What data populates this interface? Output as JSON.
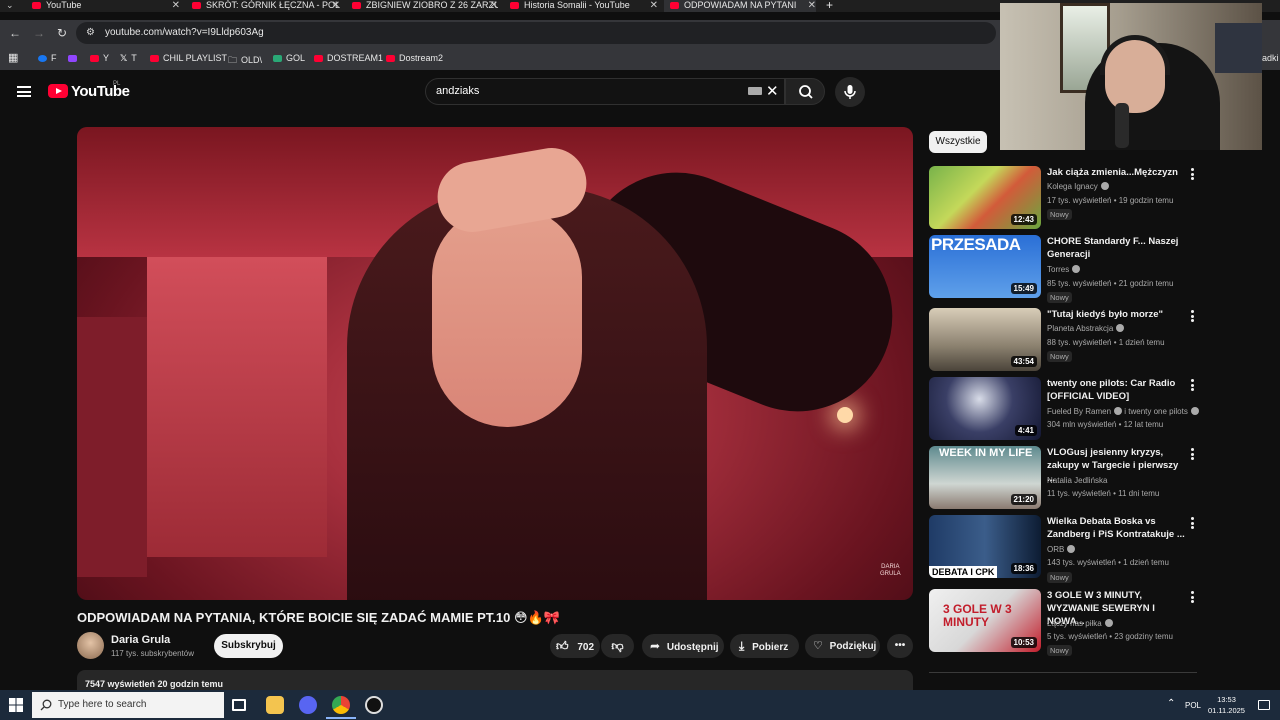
{
  "browser": {
    "tabs": [
      {
        "title": "YouTube"
      },
      {
        "title": "SKRÓT: GÓRNIK ŁĘCZNA - POL"
      },
      {
        "title": "ZBIGNIEW ZIOBRO Z 26 ZARZU"
      },
      {
        "title": "Historia Somalii - YouTube"
      },
      {
        "title": "ODPOWIADAM NA PYTANI"
      }
    ],
    "new_tab": "+",
    "url": "youtube.com/watch?v=I9Lldp603Ag",
    "bookmarks": [
      {
        "label": "F"
      },
      {
        "label": ""
      },
      {
        "label": "Y"
      },
      {
        "label": "T"
      },
      {
        "label": "CHIL PLAYLIST"
      },
      {
        "label": "OLD\\"
      },
      {
        "label": "GOL"
      },
      {
        "label": "DOSTREAM1"
      },
      {
        "label": "Dostream2"
      }
    ],
    "bookmarks_right": "adki"
  },
  "youtube": {
    "logo_text": "YouTube",
    "country_code": "PL",
    "search_value": "andziaks",
    "video": {
      "watermark_line1": "DARIA",
      "watermark_line2": "GRULA",
      "title": "ODPOWIADAM NA PYTANIA, KTÓRE BOICIE SIĘ ZADAĆ MAMIE PT.10 😳🔥🎀",
      "channel": "Daria Grula",
      "subscribers": "117 tys. subskrybentów",
      "subscribe_label": "Subskrybuj",
      "likes": "702",
      "share_label": "Udostępnij",
      "download_label": "Pobierz",
      "thanks_label": "Podziękuj",
      "views_time": "7547 wyświetleń  20 godzin temu"
    },
    "filter_chip": "Wszystkie",
    "recommendations": [
      {
        "title": "Jak ciąża zmienia...Mężczyzn",
        "channel": "Kolega Ignacy",
        "meta": "17 tys. wyświetleń • 19 godzin temu",
        "badge": "Nowy",
        "duration": "12:43"
      },
      {
        "title": "CHORE Standardy F... Naszej Generacji",
        "channel": "Torres",
        "meta": "85 tys. wyświetleń • 21 godzin temu",
        "badge": "Nowy",
        "duration": "15:49",
        "thumb_text": "PRZESADA"
      },
      {
        "title": "\"Tutaj kiedyś było morze\"",
        "channel": "Planeta Abstrakcja",
        "meta": "88 tys. wyświetleń • 1 dzień temu",
        "badge": "Nowy",
        "duration": "43:54"
      },
      {
        "title": "twenty one pilots: Car Radio [OFFICIAL VIDEO]",
        "channel": "Fueled By Ramen",
        "channel2": "i twenty one pilots",
        "meta": "304 mln wyświetleń • 12 lat temu",
        "badge": "",
        "duration": "4:41"
      },
      {
        "title": "VLOGusj jesienny kryzys, zakupy w Targecie i pierwszy ...",
        "channel": "Natalia Jedlińska",
        "meta": "11 tys. wyświetleń • 11 dni temu",
        "badge": "",
        "duration": "21:20",
        "thumb_text": "WEEK IN MY LIFE"
      },
      {
        "title": "Wielka Debata Boska vs Zandberg i PiS Kontratakuje ...",
        "channel": "ORB",
        "meta": "143 tys. wyświetleń • 1 dzień temu",
        "badge": "Nowy",
        "duration": "18:36",
        "thumb_text": "DEBATA I CPK"
      },
      {
        "title": "3 GOLE W 3 MINUTY, WYZWANIE SEWERYN I NOWA...",
        "channel": "Łączy nas piłka",
        "meta": "5 tys. wyświetleń • 23 godziny temu",
        "badge": "Nowy",
        "duration": "10:53",
        "thumb_text": "3 GOLE W 3 MINUTY"
      }
    ]
  },
  "taskbar": {
    "search_placeholder": "Type here to search",
    "language": "POL",
    "time": "13:53",
    "date": "01.11.2025"
  },
  "colors": {
    "youtube_red": "#ff0033",
    "background": "#0f0f0f",
    "taskbar": "#1c2a3b"
  }
}
